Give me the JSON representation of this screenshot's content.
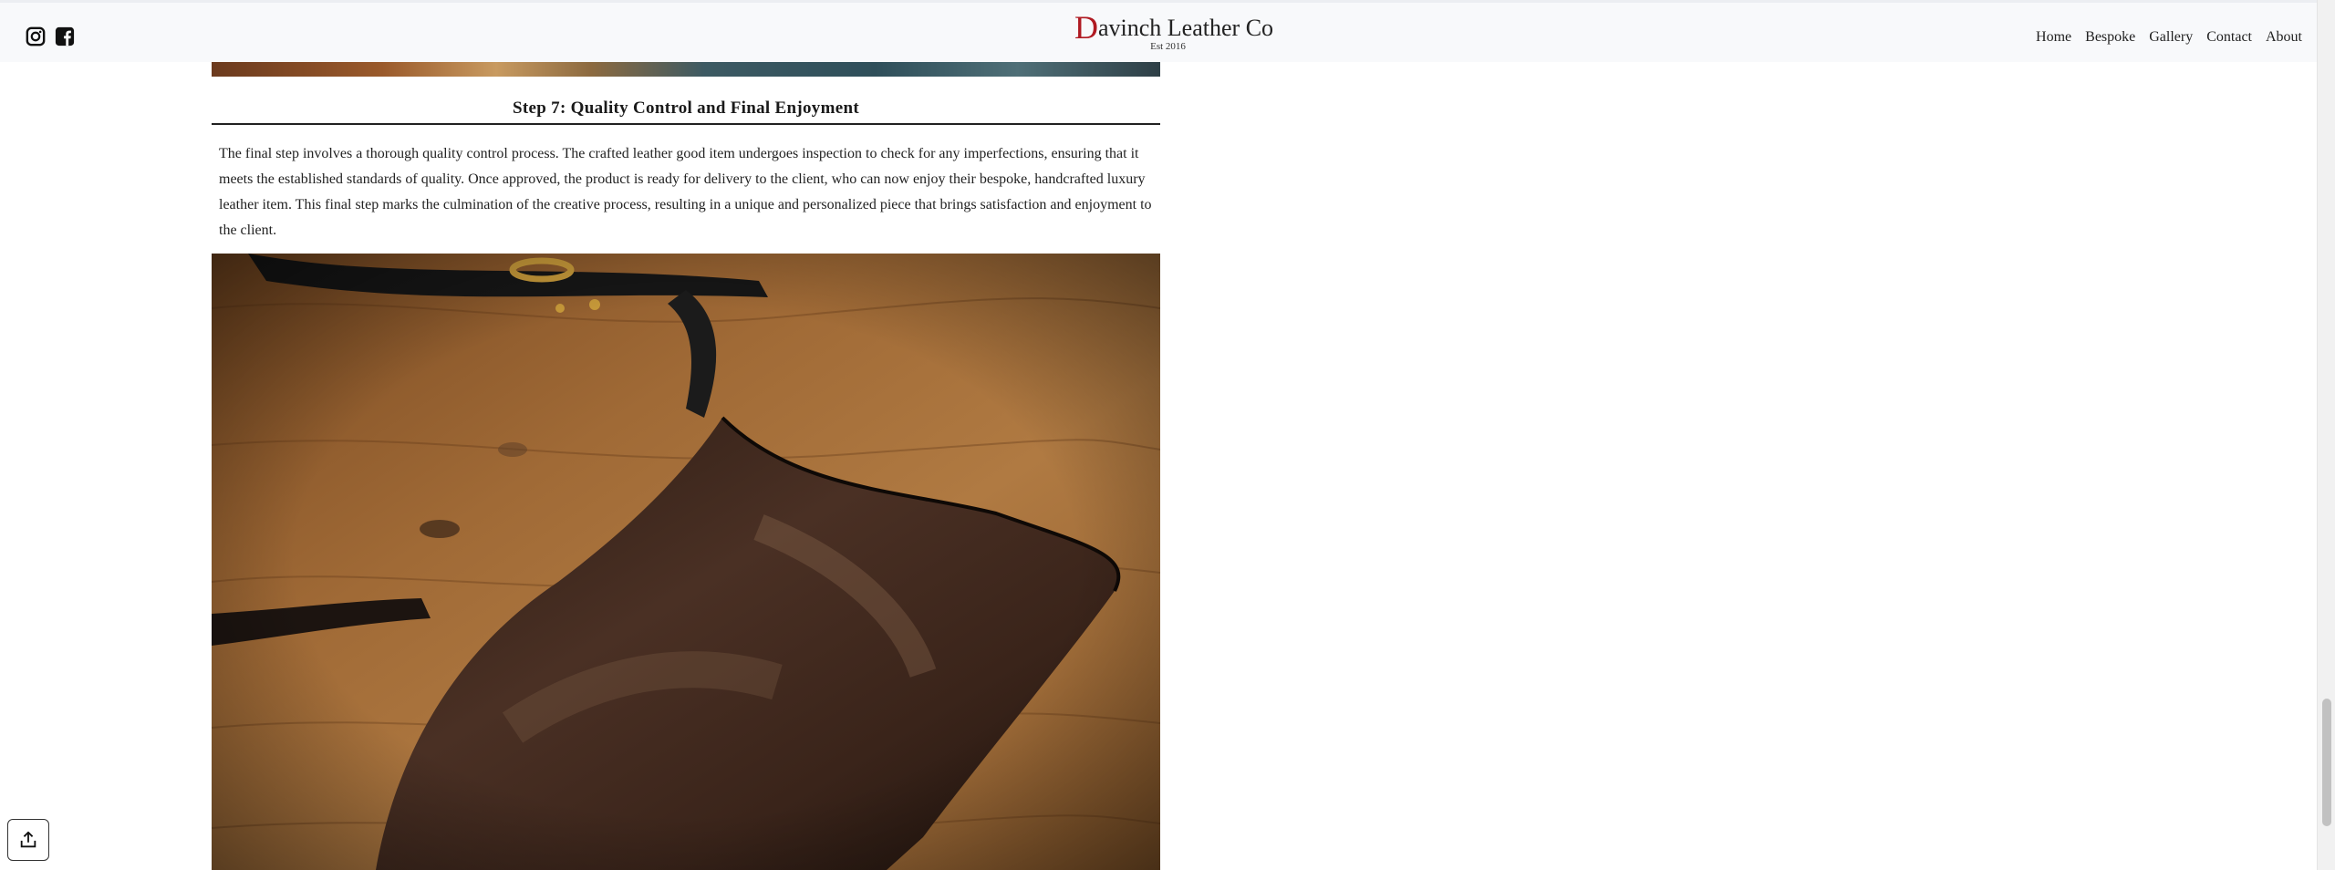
{
  "header": {
    "brand_initial": "D",
    "brand_rest": "avinch Leather Co",
    "brand_est": "Est 2016",
    "nav": [
      "Home",
      "Bespoke",
      "Gallery",
      "Contact",
      "About"
    ],
    "social_icons": [
      "instagram-icon",
      "facebook-icon"
    ]
  },
  "article": {
    "step_heading": "Step 7: Quality Control and Final Enjoyment",
    "body": "The final step involves a thorough quality control process. The crafted leather good item undergoes inspection to check for any imperfections, ensuring that it meets the established standards of quality. Once approved, the product is ready for delivery to the client, who can now enjoy their bespoke, handcrafted luxury leather item. This final step marks the culmination of the creative process, resulting in a unique and personalized piece that brings satisfaction and enjoyment to the client."
  },
  "colors": {
    "brand_initial": "#b01a22",
    "header_bg": "#f8f9fb",
    "text": "#1a1a1a"
  },
  "floating": {
    "share_icon": "share-upload-icon"
  }
}
